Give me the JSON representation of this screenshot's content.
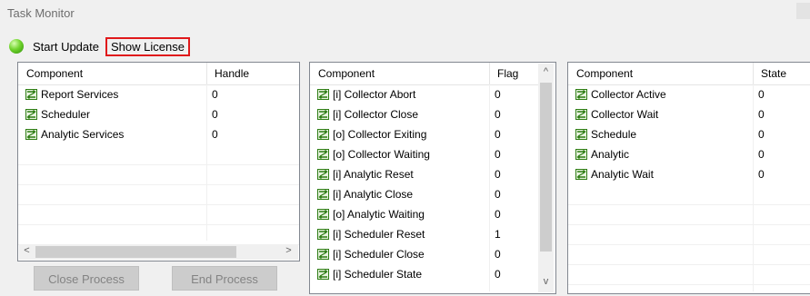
{
  "window": {
    "title": "Task Monitor"
  },
  "toolbar": {
    "start_update": "Start Update",
    "show_license": "Show License"
  },
  "left_panel": {
    "columns": [
      "Component",
      "Handle"
    ],
    "rows": [
      {
        "component": "Report Services",
        "value": "0"
      },
      {
        "component": "Scheduler",
        "value": "0"
      },
      {
        "component": "Analytic Services",
        "value": "0"
      }
    ],
    "scroll_left": "<",
    "scroll_right": ">"
  },
  "middle_panel": {
    "columns": [
      "Component",
      "Flag"
    ],
    "rows": [
      {
        "component": "[i] Collector Abort",
        "value": "0"
      },
      {
        "component": "[i] Collector Close",
        "value": "0"
      },
      {
        "component": "[o] Collector Exiting",
        "value": "0"
      },
      {
        "component": "[o] Collector Waiting",
        "value": "0"
      },
      {
        "component": "[i] Analytic Reset",
        "value": "0"
      },
      {
        "component": "[i] Analytic Close",
        "value": "0"
      },
      {
        "component": "[o] Analytic Waiting",
        "value": "0"
      },
      {
        "component": "[i] Scheduler Reset",
        "value": "1"
      },
      {
        "component": "[i] Scheduler Close",
        "value": "0"
      },
      {
        "component": "[i] Scheduler State",
        "value": "0"
      }
    ],
    "scroll_up": "^",
    "scroll_down": "v"
  },
  "right_panel": {
    "columns": [
      "Component",
      "State"
    ],
    "rows": [
      {
        "component": "Collector Active",
        "value": "0"
      },
      {
        "component": "Collector Wait",
        "value": "0"
      },
      {
        "component": "Schedule",
        "value": "0"
      },
      {
        "component": "Analytic",
        "value": "0"
      },
      {
        "component": "Analytic Wait",
        "value": "0"
      }
    ]
  },
  "buttons": {
    "close_process": "Close Process",
    "end_process": "End Process"
  },
  "icons": {
    "row_icon": "component-icon",
    "status_orb": "green-status-orb-icon"
  },
  "colors": {
    "highlight_border": "#e0191b",
    "icon_green": "#2e7d14"
  }
}
